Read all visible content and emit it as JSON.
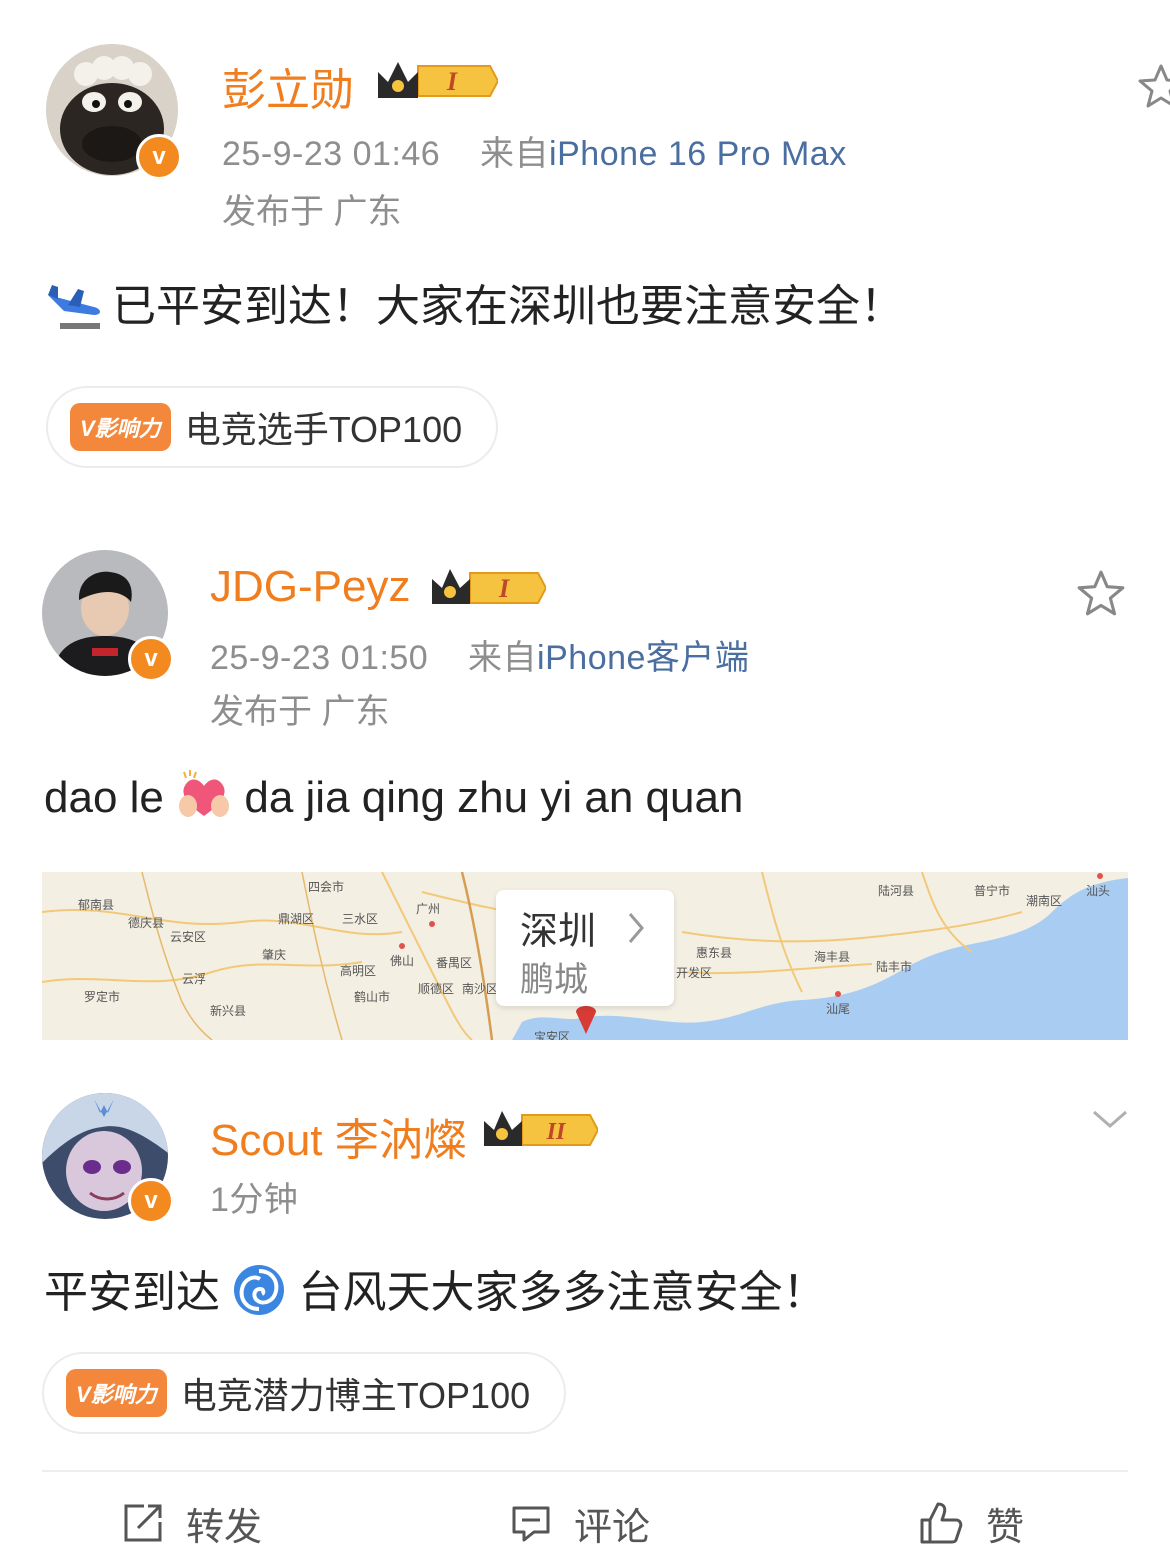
{
  "posts": [
    {
      "username": "彭立勋",
      "level": "I",
      "time": "25-9-23 01:46",
      "from_label": "来自",
      "device": "iPhone 16 Pro Max",
      "location": "发布于 广东",
      "content": "已平安到达！大家在深圳也要注意安全！",
      "emoji_icon": "airplane-icon",
      "influence_tag": "V影响力",
      "influence_text": "电竞选手TOP100"
    },
    {
      "username": "JDG-Peyz",
      "level": "I",
      "time": "25-9-23 01:50",
      "from_label": "来自",
      "device": "iPhone客户端",
      "location": "发布于 广东",
      "content_before": "dao le",
      "content_after": "da jia qing zhu yi an quan",
      "emoji_icon": "heart-hands-icon",
      "map": {
        "city": "深圳",
        "district": "鹏城",
        "labels": [
          "郁南县",
          "德庆县",
          "云安区",
          "云浮",
          "罗定市",
          "新兴县",
          "四会市",
          "鼎湖区",
          "三水区",
          "肇庆",
          "高明区",
          "鹤山市",
          "佛山",
          "广州",
          "番禺区",
          "顺德区",
          "南沙区",
          "宝安区",
          "惠东县",
          "开发区",
          "海丰县",
          "陆河县",
          "陆丰市",
          "汕尾",
          "普宁市",
          "潮南区",
          "汕头"
        ]
      }
    },
    {
      "username": "Scout 李汭燦",
      "level": "II",
      "time": "1分钟",
      "content_before": "平安到达",
      "content_after": "台风天大家多多注意安全！",
      "emoji_icon": "cyclone-icon",
      "influence_tag": "V影响力",
      "influence_text": "电竞潜力博主TOP100"
    }
  ],
  "actions": {
    "repost": "转发",
    "comment": "评论",
    "like": "赞"
  },
  "colors": {
    "username": "#f07d1e",
    "verified": "#f28a1f",
    "device_link": "#4a6ea0",
    "meta": "#8e8e8e"
  }
}
